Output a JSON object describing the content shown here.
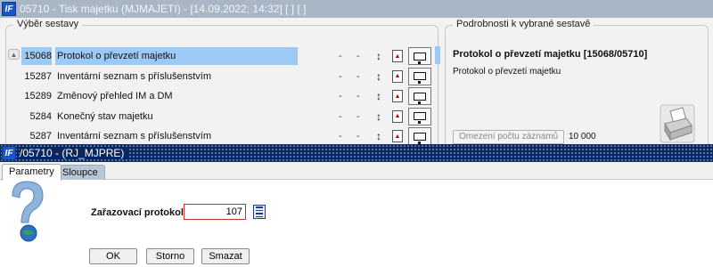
{
  "back_window": {
    "title": "05710 - Tisk majetku (MJMAJETI) - [14.09.2022; 14:32]  [ ]  [ ]",
    "left_group_title": "Výběr sestavy",
    "rows": [
      {
        "code": "15068",
        "name": "Protokol o převzetí majetku",
        "selected": true
      },
      {
        "code": "15287",
        "name": "Inventární seznam s příslušenstvím",
        "selected": false
      },
      {
        "code": "15289",
        "name": "Změnový přehled IM a DM",
        "selected": false
      },
      {
        "code": "5284",
        "name": "Konečný stav majetku",
        "selected": false
      },
      {
        "code": "5287",
        "name": "Inventární seznam s příslušenstvím",
        "selected": false
      }
    ],
    "dash": "-",
    "right_group_title": "Podrobnosti k vybrané sestavě",
    "detail_title": "Protokol o převzetí majetku [15068/05710]",
    "detail_subtitle": "Protokol o převzetí majetku",
    "limit_button": "Omezení počtu záznamů",
    "limit_value": "10 000"
  },
  "dialog": {
    "title": "/05710 - (RJ_MJPRE)",
    "tabs": [
      "Parametry",
      "Sloupce"
    ],
    "field_label": "Zařazovací protokol:",
    "field_value": "107",
    "buttons": {
      "ok": "OK",
      "storno": "Storno",
      "smazat": "Smazat"
    }
  },
  "icons": {
    "logo": "app-logo-icon",
    "sort": "sort-arrows-icon",
    "pdf": "pdf-icon",
    "monitor": "monitor-icon",
    "printer": "printer-icon",
    "help": "question-mark-icon",
    "list": "list-icon"
  },
  "colors": {
    "selection": "#9dc9f5",
    "dialog_titlebar": "#09275e",
    "back_titlebar": "#a8b6c6",
    "required_border": "#d03030"
  }
}
